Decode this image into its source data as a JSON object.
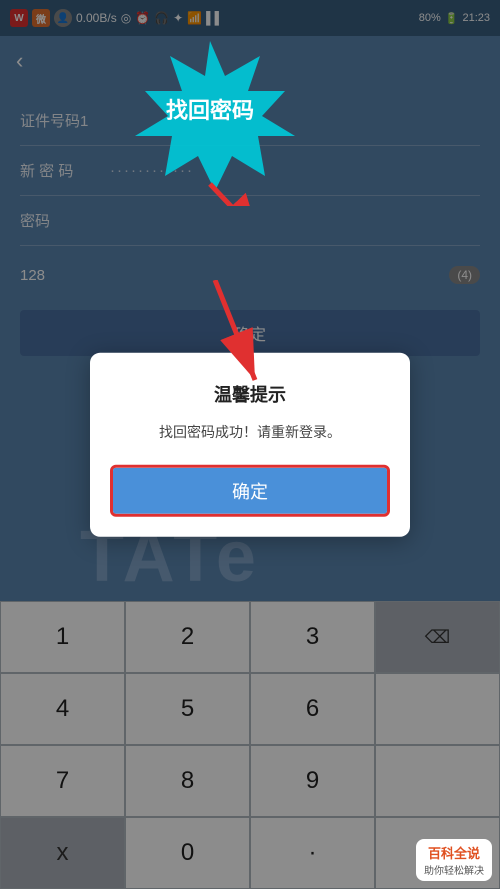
{
  "statusBar": {
    "network": "0.00B/s",
    "battery": "80%",
    "time": "21:23",
    "icons": [
      "红",
      "橙",
      "头"
    ]
  },
  "header": {
    "backLabel": "‹"
  },
  "form": {
    "fields": [
      {
        "label": "证件号码1",
        "value": ""
      },
      {
        "label": "新 密 码",
        "value": "············"
      },
      {
        "label": "密码",
        "value": ""
      }
    ],
    "numDisplay": "128",
    "numBadge": "(4)"
  },
  "confirmBtn": {
    "label": "确定"
  },
  "keypad": {
    "rows": [
      [
        "1",
        "2",
        "3"
      ],
      [
        "4",
        "5",
        "6"
      ],
      [
        "7",
        "8",
        "9"
      ],
      [
        "x",
        "0",
        "·"
      ]
    ],
    "deleteKey": "⌫"
  },
  "dialog": {
    "title": "温馨提示",
    "message": "找回密码成功！请重新登录。",
    "confirmLabel": "确定"
  },
  "annotation": {
    "bubbleText": "找回密码"
  },
  "watermark": {
    "title": "百科全说",
    "subtitle": "助你轻松解决"
  },
  "tate": "TATe"
}
